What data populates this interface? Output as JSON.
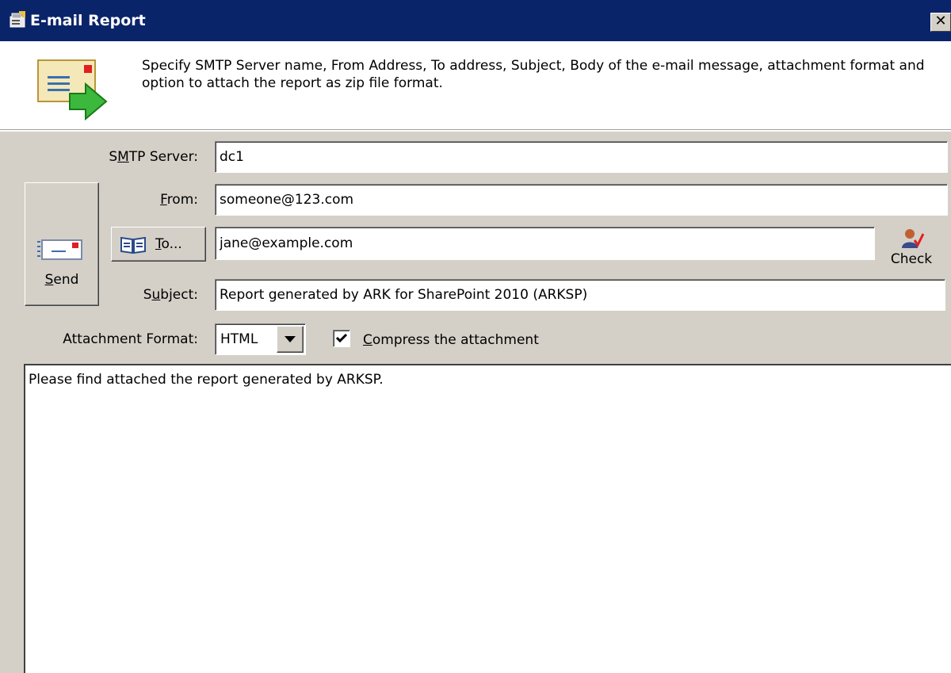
{
  "window": {
    "title": "E-mail Report",
    "close_label": "✕"
  },
  "header": {
    "description": "Specify SMTP Server name, From Address, To address, Subject, Body of the e-mail message, attachment format and option to attach the report as zip file format."
  },
  "form": {
    "smtp_label_pre": "S",
    "smtp_label_key": "M",
    "smtp_label_post": "TP Server:",
    "smtp_value": "dc1",
    "from_label_key": "F",
    "from_label_post": "rom:",
    "from_value": "someone@123.com",
    "to_button_key": "T",
    "to_button_post": "o...",
    "to_value": "jane@example.com",
    "check_label": "Check",
    "subject_label_pre": "S",
    "subject_label_key": "u",
    "subject_label_post": "bject:",
    "subject_value": "Report generated by ARK for SharePoint 2010 (ARKSP)",
    "send_label_key": "S",
    "send_label_post": "end",
    "attachment_label": "Attachment Format:",
    "attachment_value": "HTML",
    "compress_key": "C",
    "compress_post": "ompress the attachment",
    "compress_checked": true,
    "body_text": "Please find attached the report generated by ARKSP."
  }
}
